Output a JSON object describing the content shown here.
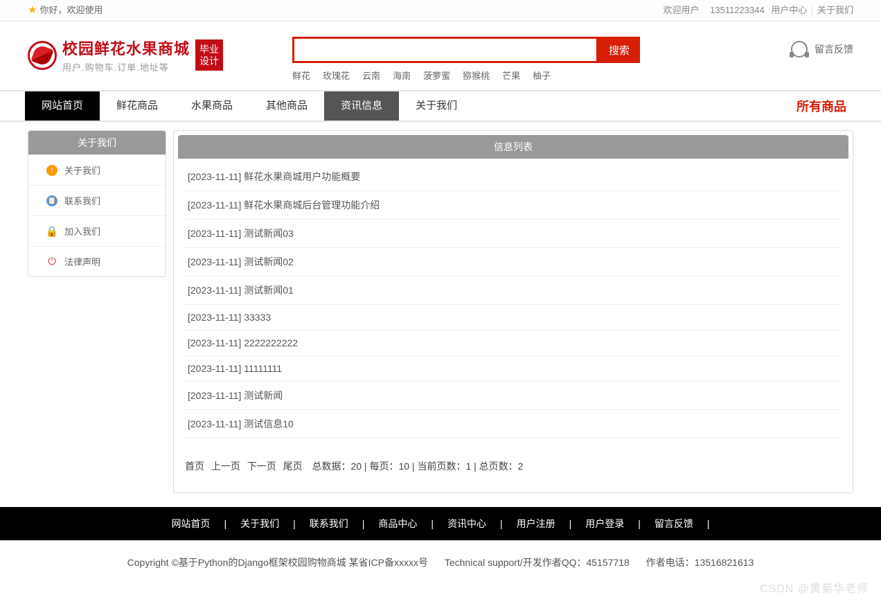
{
  "topbar": {
    "welcome": "你好，欢迎使用",
    "user_label": "欢迎用户",
    "user_phone": "13511223344",
    "user_center": "用户中心",
    "about": "关于我们"
  },
  "logo": {
    "title": "校园鲜花水果商城",
    "subtitle": "用户.购物车.订单.地址等",
    "badge_l1": "毕业",
    "badge_l2": "设计"
  },
  "search": {
    "button": "搜索",
    "hints": [
      "鲜花",
      "玫瑰花",
      "云南",
      "海南",
      "菠萝蜜",
      "猕猴桃",
      "芒果",
      "柚子"
    ]
  },
  "feedback": {
    "label": "留言反馈"
  },
  "nav": {
    "items": [
      {
        "label": "网站首页",
        "cls": "dark"
      },
      {
        "label": "鲜花商品",
        "cls": ""
      },
      {
        "label": "水果商品",
        "cls": ""
      },
      {
        "label": "其他商品",
        "cls": ""
      },
      {
        "label": "资讯信息",
        "cls": "gray"
      },
      {
        "label": "关于我们",
        "cls": ""
      }
    ],
    "all": "所有商品"
  },
  "sidebar": {
    "title": "关于我们",
    "items": [
      {
        "label": "关于我们",
        "icon": "ic-orange",
        "glyph": "i"
      },
      {
        "label": "联系我们",
        "icon": "ic-blue",
        "glyph": "✎"
      },
      {
        "label": "加入我们",
        "icon": "",
        "glyph": ""
      },
      {
        "label": "法律声明",
        "icon": "",
        "glyph": ""
      }
    ]
  },
  "content": {
    "title": "信息列表",
    "rows": [
      "[2023-11-11] 鲜花水果商城用户功能概要",
      "[2023-11-11] 鲜花水果商城后台管理功能介绍",
      "[2023-11-11] 测试新闻03",
      "[2023-11-11] 测试新闻02",
      "[2023-11-11] 测试新闻01",
      "[2023-11-11] 33333",
      "[2023-11-11] 2222222222",
      "[2023-11-11] 11111111",
      "[2023-11-11] 测试新闻",
      "[2023-11-11] 测试信息10"
    ]
  },
  "pager": {
    "first": "首页",
    "prev": "上一页",
    "next": "下一页",
    "last": "尾页",
    "total_label": "总数据：",
    "total": "20",
    "per_label": " | 每页：",
    "per": "10",
    "cur_label": " | 当前页数：",
    "cur": "1",
    "pages_label": " | 总页数：",
    "pages": "2"
  },
  "footer_nav": [
    "网站首页",
    "关于我们",
    "联系我们",
    "商品中心",
    "资讯中心",
    "用户注册",
    "用户登录",
    "留言反馈"
  ],
  "footer_info": {
    "copyright": "Copyright ©基于Python的Django框架校园购物商城 某省ICP备xxxxx号",
    "tech": "Technical support/开发作者QQ：45157718",
    "phone": "作者电话：13516821613"
  },
  "watermark": "CSDN @黄菊华老师"
}
